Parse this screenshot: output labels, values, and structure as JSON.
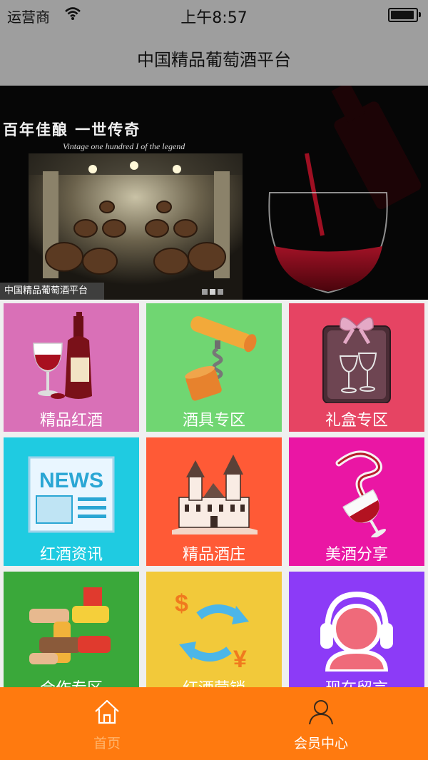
{
  "status_bar": {
    "carrier": "运营商",
    "time": "上午8:57",
    "battery_level": 0.95
  },
  "nav": {
    "title": "中国精品葡萄酒平台"
  },
  "banner": {
    "slogan": "百年佳酿  一世传奇",
    "subslogan": "Vintage one hundred I of the legend",
    "caption": "中国精品葡萄酒平台",
    "page_count": 3,
    "active_page": 1
  },
  "grid": {
    "tiles": [
      {
        "label": "精品红酒",
        "color": "#d970b7",
        "icon": "wine-bottle-glass-icon"
      },
      {
        "label": "酒具专区",
        "color": "#70d672",
        "icon": "corkscrew-icon"
      },
      {
        "label": "礼盒专区",
        "color": "#e64463",
        "icon": "gift-box-icon"
      },
      {
        "label": "红酒资讯",
        "color": "#1fcbe1",
        "icon": "news-icon"
      },
      {
        "label": "精品酒庄",
        "color": "#ff5a36",
        "icon": "chateau-icon"
      },
      {
        "label": "美酒分享",
        "color": "#ea16a4",
        "icon": "wine-pour-icon"
      },
      {
        "label": "合作专区",
        "color": "#3aa83a",
        "icon": "hands-cooperation-icon"
      },
      {
        "label": "红酒营销",
        "color": "#f2c93a",
        "icon": "currency-exchange-icon"
      },
      {
        "label": "现在留言",
        "color": "#8c3bf7",
        "icon": "headset-support-icon"
      }
    ]
  },
  "tabbar": {
    "background": "#ff7a0f",
    "tabs": [
      {
        "label": "首页",
        "icon": "home-icon",
        "active": true
      },
      {
        "label": "会员中心",
        "icon": "user-icon",
        "active": false
      }
    ]
  }
}
